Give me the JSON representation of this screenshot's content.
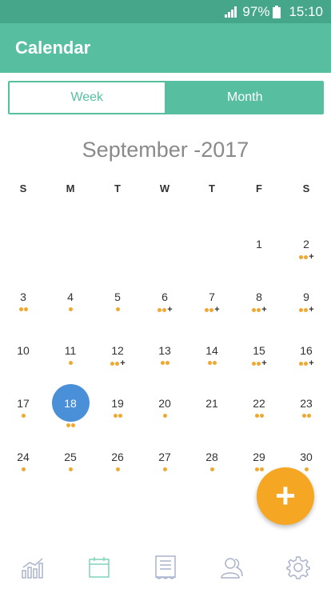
{
  "status": {
    "battery": "97%",
    "time": "15:10"
  },
  "app": {
    "title": "Calendar"
  },
  "toggle": {
    "week": "Week",
    "month": "Month"
  },
  "calendar": {
    "title": "September -2017",
    "weekdays": [
      "S",
      "M",
      "T",
      "W",
      "T",
      "F",
      "S"
    ],
    "selected_day": "18",
    "days": [
      {
        "d": "1",
        "dots": 0,
        "plus": false
      },
      {
        "d": "2",
        "dots": 2,
        "plus": true
      },
      {
        "d": "3",
        "dots": 2,
        "plus": false
      },
      {
        "d": "4",
        "dots": 1,
        "plus": false
      },
      {
        "d": "5",
        "dots": 1,
        "plus": false
      },
      {
        "d": "6",
        "dots": 2,
        "plus": true
      },
      {
        "d": "7",
        "dots": 2,
        "plus": true
      },
      {
        "d": "8",
        "dots": 2,
        "plus": true
      },
      {
        "d": "9",
        "dots": 2,
        "plus": true
      },
      {
        "d": "10",
        "dots": 0,
        "plus": false
      },
      {
        "d": "11",
        "dots": 1,
        "plus": false
      },
      {
        "d": "12",
        "dots": 2,
        "plus": true
      },
      {
        "d": "13",
        "dots": 2,
        "plus": false
      },
      {
        "d": "14",
        "dots": 2,
        "plus": false
      },
      {
        "d": "15",
        "dots": 2,
        "plus": true
      },
      {
        "d": "16",
        "dots": 2,
        "plus": true
      },
      {
        "d": "17",
        "dots": 1,
        "plus": false
      },
      {
        "d": "18",
        "dots": 2,
        "plus": false
      },
      {
        "d": "19",
        "dots": 2,
        "plus": false
      },
      {
        "d": "20",
        "dots": 1,
        "plus": false
      },
      {
        "d": "21",
        "dots": 0,
        "plus": false
      },
      {
        "d": "22",
        "dots": 2,
        "plus": false
      },
      {
        "d": "23",
        "dots": 2,
        "plus": false
      },
      {
        "d": "24",
        "dots": 1,
        "plus": false
      },
      {
        "d": "25",
        "dots": 1,
        "plus": false
      },
      {
        "d": "26",
        "dots": 1,
        "plus": false
      },
      {
        "d": "27",
        "dots": 1,
        "plus": false
      },
      {
        "d": "28",
        "dots": 1,
        "plus": false
      },
      {
        "d": "29",
        "dots": 2,
        "plus": false
      },
      {
        "d": "30",
        "dots": 1,
        "plus": false
      }
    ],
    "first_weekday_index": 5
  },
  "fab": {
    "label": "+"
  },
  "nav": [
    "stats-icon",
    "calendar-icon",
    "receipt-icon",
    "contacts-icon",
    "settings-icon"
  ],
  "colors": {
    "primary": "#57bfa0",
    "accent": "#f5a623",
    "selected": "#4a90d9",
    "dot": "#f0a830"
  }
}
